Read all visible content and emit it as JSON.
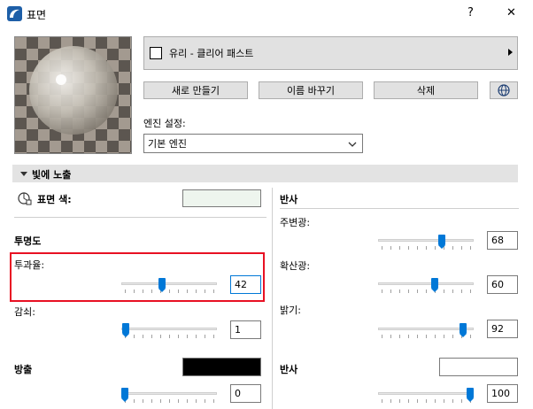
{
  "window": {
    "title": "표면",
    "help_label": "?",
    "close_label": "✕"
  },
  "material": {
    "name": "유리 - 클리어 패스트",
    "new_label": "새로 만들기",
    "rename_label": "이름 바꾸기",
    "delete_label": "삭제",
    "engine_label": "엔진 설정:",
    "engine_value": "기본 엔진"
  },
  "section": {
    "title": "빛에 노출"
  },
  "left": {
    "surface_color_label": "표면 색:",
    "surface_color": "#eef5ee",
    "transparency_label": "투명도",
    "transmission_label": "투과율:",
    "transmission_value": "42",
    "attenuation_label": "감쇠:",
    "attenuation_value": "1",
    "emission_label": "방출",
    "emission_color": "#000000",
    "emission_value": "0"
  },
  "right": {
    "reflection_label": "반사",
    "ambient_label": "주변광:",
    "ambient_value": "68",
    "diffuse_label": "확산광:",
    "diffuse_value": "60",
    "brightness_label": "밝기:",
    "brightness_value": "92",
    "reflection2_label": "반사",
    "reflection_color": "#ffffff",
    "reflection_value": "100"
  },
  "sliders": {
    "transmission": 0.42,
    "attenuation": 0.01,
    "emission": 0.0,
    "ambient": 0.68,
    "diffuse": 0.6,
    "brightness": 0.92,
    "reflection": 1.0
  },
  "colors": {
    "highlight_border": "#e81123",
    "accent": "#0078d7"
  }
}
